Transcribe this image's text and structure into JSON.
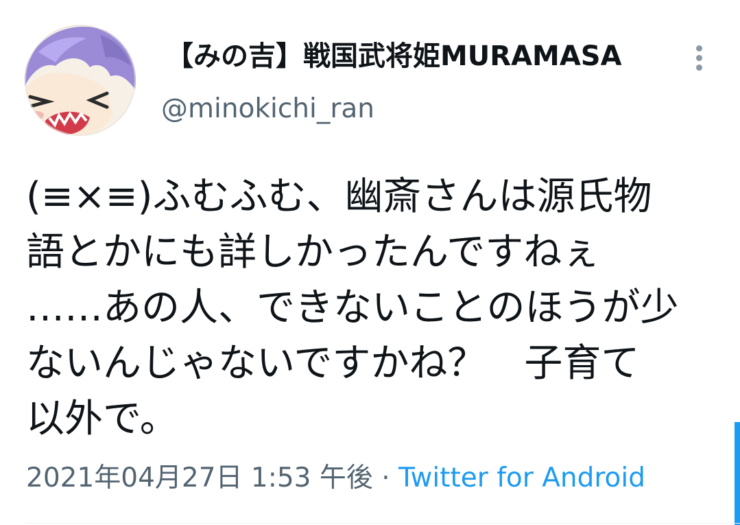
{
  "tweet": {
    "author": {
      "display_name": "【みの吉】戦国武将姫MURAMASA",
      "handle": "@minokichi_ran"
    },
    "text_lines": [
      "(≡×≡)ふむふむ、幽斎さんは源氏物",
      "語とかにも詳しかったんですねぇ",
      "……あの人、できないことのほうが少",
      "ないんじゃないですかね？　子育て",
      "以外で。"
    ],
    "timestamp": "2021年04月27日 1:53 午後",
    "separator": " · ",
    "source": "Twitter for Android"
  },
  "icons": {
    "menu": "more-vertical-icon",
    "avatar": "avatar-image"
  },
  "colors": {
    "text": "#0f1419",
    "secondary": "#536471",
    "link": "#1d9bf0"
  }
}
